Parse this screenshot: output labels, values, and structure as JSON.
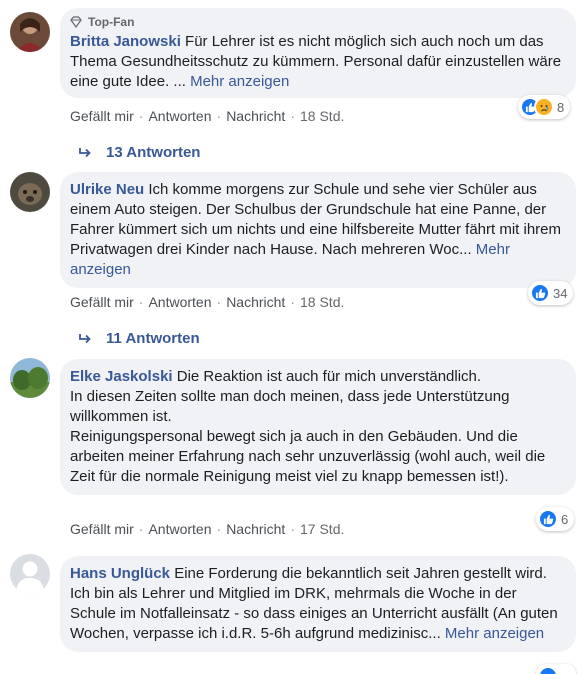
{
  "comments": [
    {
      "badge": "Top-Fan",
      "author": "Britta Janowski",
      "text": "Für Lehrer ist es nicht möglich sich auch noch um das Thema Gesundheitsschutz zu kümmern. Personal dafür einzustellen wäre eine gute Idee. ...",
      "more": "Mehr anzeigen",
      "like_label": "Gefällt mir",
      "reply_label": "Antworten",
      "message_label": "Nachricht",
      "time": "18 Std.",
      "reaction_count": "8",
      "replies_label": "13 Antworten"
    },
    {
      "author": "Ulrike Neu",
      "text": "Ich komme morgens zur Schule und sehe vier Schüler aus einem Auto steigen. Der Schulbus der Grundschule hat eine Panne, der Fahrer kümmert sich um nichts und eine hilfsbereite Mutter fährt mit ihrem Privatwagen drei Kinder nach Hause. Nach mehreren Woc...",
      "more": "Mehr anzeigen",
      "like_label": "Gefällt mir",
      "reply_label": "Antworten",
      "message_label": "Nachricht",
      "time": "18 Std.",
      "reaction_count": "34",
      "replies_label": "11 Antworten"
    },
    {
      "author": "Elke Jaskolski",
      "text": "Die Reaktion ist auch für mich unverständlich.",
      "text_lines": [
        "In diesen Zeiten sollte man doch meinen, dass jede Unterstützung willkommen ist.",
        "Reinigungspersonal bewegt sich ja auch in den Gebäuden. Und die arbeiten meiner Erfahrung nach sehr unzuverlässig (wohl auch, weil die Zeit für die normale Reinigung meist viel zu knapp bemessen ist!)."
      ],
      "like_label": "Gefällt mir",
      "reply_label": "Antworten",
      "message_label": "Nachricht",
      "time": "17 Std.",
      "reaction_count": "6"
    },
    {
      "author": "Hans Unglück",
      "text": "Eine Forderung die bekanntlich seit Jahren gestellt wird. Ich bin als Lehrer und Mitglied im DRK, mehrmals die Woche in der Schule im Notfalleinsatz - so dass einiges an Unterricht ausfällt (An guten Wochen, verpasse ich i.d.R. 5-6h aufgrund medizinisc...",
      "more": "Mehr anzeigen"
    }
  ],
  "colors": {
    "author": "#385898",
    "bubble": "#f0f2f5",
    "like_reaction": "#1877f2",
    "sad_reaction": "#f7b125"
  },
  "icons": [
    "diamond-icon",
    "like-reaction-icon",
    "sad-reaction-icon",
    "reply-arrow-icon"
  ]
}
